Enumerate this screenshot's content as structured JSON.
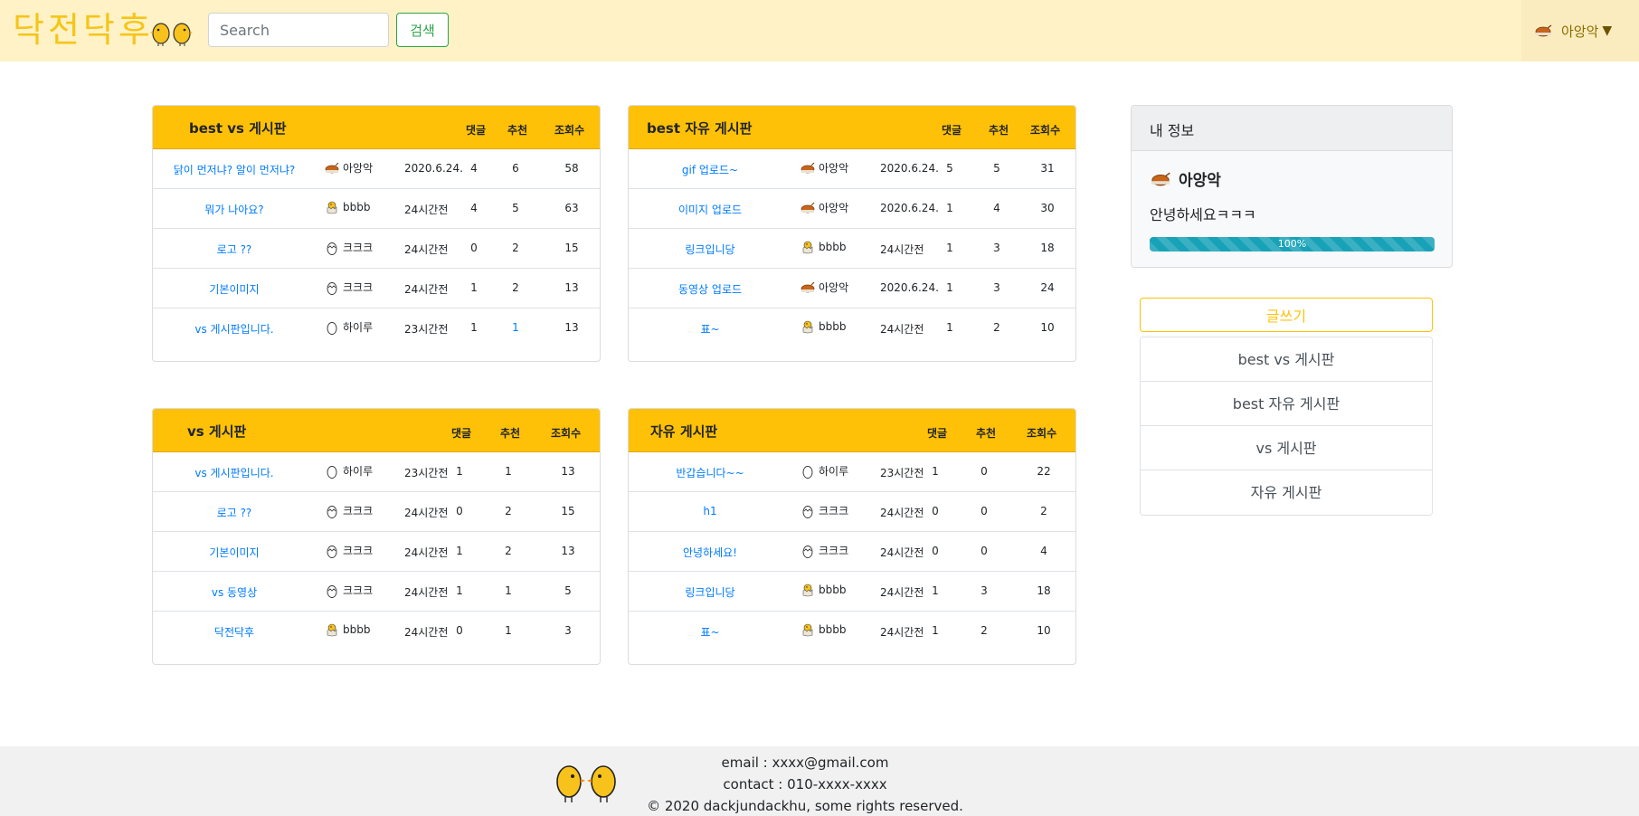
{
  "header": {
    "brand": "닥전닥후",
    "search_placeholder": "Search",
    "search_button": "검색",
    "user_name": "아앙악",
    "user_caret": "▼"
  },
  "columns": {
    "comments": "댓글",
    "likes": "추천",
    "views": "조회수"
  },
  "boards": [
    {
      "title": "best vs 게시판",
      "rows": [
        {
          "title": "닭이 먼저냐? 알이 먼저냐?",
          "author": "아앙악",
          "avatar": "roast-chicken",
          "date": "2020.6.24.",
          "comments": "4",
          "likes": "6",
          "views": "58"
        },
        {
          "title": "뭐가 나아요?",
          "author": "bbbb",
          "avatar": "hatching-chick",
          "date": "24시간전",
          "comments": "4",
          "likes": "5",
          "views": "63"
        },
        {
          "title": "로고 ??",
          "author": "크크크",
          "avatar": "cracked-egg",
          "date": "24시간전",
          "comments": "0",
          "likes": "2",
          "views": "15"
        },
        {
          "title": "기본이미지",
          "author": "크크크",
          "avatar": "cracked-egg",
          "date": "24시간전",
          "comments": "1",
          "likes": "2",
          "views": "13"
        },
        {
          "title": "vs 게시판입니다.",
          "author": "하이루",
          "avatar": "egg",
          "date": "23시간전",
          "comments": "1",
          "likes": "1",
          "views": "13"
        }
      ]
    },
    {
      "title": "best 자유 게시판",
      "rows": [
        {
          "title": "gif 업로드~",
          "author": "아앙악",
          "avatar": "roast-chicken",
          "date": "2020.6.24.",
          "comments": "5",
          "likes": "5",
          "views": "31"
        },
        {
          "title": "이미지 업로드",
          "author": "아앙악",
          "avatar": "roast-chicken",
          "date": "2020.6.24.",
          "comments": "1",
          "likes": "4",
          "views": "30"
        },
        {
          "title": "링크입니당",
          "author": "bbbb",
          "avatar": "hatching-chick",
          "date": "24시간전",
          "comments": "1",
          "likes": "3",
          "views": "18"
        },
        {
          "title": "동영상 업로드",
          "author": "아앙악",
          "avatar": "roast-chicken",
          "date": "2020.6.24.",
          "comments": "1",
          "likes": "3",
          "views": "24"
        },
        {
          "title": "표~",
          "author": "bbbb",
          "avatar": "hatching-chick",
          "date": "24시간전",
          "comments": "1",
          "likes": "2",
          "views": "10"
        }
      ]
    },
    {
      "title": "vs 게시판",
      "rows": [
        {
          "title": "vs 게시판입니다.",
          "author": "하이루",
          "avatar": "egg",
          "date": "23시간전",
          "comments": "1",
          "likes": "1",
          "views": "13"
        },
        {
          "title": "로고 ??",
          "author": "크크크",
          "avatar": "cracked-egg",
          "date": "24시간전",
          "comments": "0",
          "likes": "2",
          "views": "15"
        },
        {
          "title": "기본이미지",
          "author": "크크크",
          "avatar": "cracked-egg",
          "date": "24시간전",
          "comments": "1",
          "likes": "2",
          "views": "13"
        },
        {
          "title": "vs 동영상",
          "author": "크크크",
          "avatar": "cracked-egg",
          "date": "24시간전",
          "comments": "1",
          "likes": "1",
          "views": "5"
        },
        {
          "title": "닥전닥후",
          "author": "bbbb",
          "avatar": "hatching-chick",
          "date": "24시간전",
          "comments": "0",
          "likes": "1",
          "views": "3"
        }
      ]
    },
    {
      "title": "자유 게시판",
      "rows": [
        {
          "title": "반갑습니다~~",
          "author": "하이루",
          "avatar": "egg",
          "date": "23시간전",
          "comments": "1",
          "likes": "0",
          "views": "22"
        },
        {
          "title": "h1",
          "author": "크크크",
          "avatar": "cracked-egg",
          "date": "24시간전",
          "comments": "0",
          "likes": "0",
          "views": "2"
        },
        {
          "title": "안녕하세요!",
          "author": "크크크",
          "avatar": "cracked-egg",
          "date": "24시간전",
          "comments": "0",
          "likes": "0",
          "views": "4"
        },
        {
          "title": "링크입니당",
          "author": "bbbb",
          "avatar": "hatching-chick",
          "date": "24시간전",
          "comments": "1",
          "likes": "3",
          "views": "18"
        },
        {
          "title": "표~",
          "author": "bbbb",
          "avatar": "hatching-chick",
          "date": "24시간전",
          "comments": "1",
          "likes": "2",
          "views": "10"
        }
      ]
    }
  ],
  "info": {
    "header": "내 정보",
    "name": "아앙악",
    "greeting": "안녕하세요ㅋㅋㅋ",
    "progress_value": 100,
    "progress_label": "100%"
  },
  "sidebar": {
    "write_button": "글쓰기",
    "items": [
      "best vs 게시판",
      "best 자유 게시판",
      "vs 게시판",
      "자유 게시판"
    ]
  },
  "footer": {
    "email": "email : xxxx@gmail.com",
    "contact": "contact : 010-xxxx-xxxx",
    "copyright": "© 2020 dackjundackhu, some rights reserved."
  },
  "colors": {
    "navbar_bg": "#fff2c6",
    "brand": "#f5c518",
    "board_header": "#ffc107",
    "link": "#007bff",
    "progress": "#17a2b8",
    "search_button": "#28a745"
  }
}
